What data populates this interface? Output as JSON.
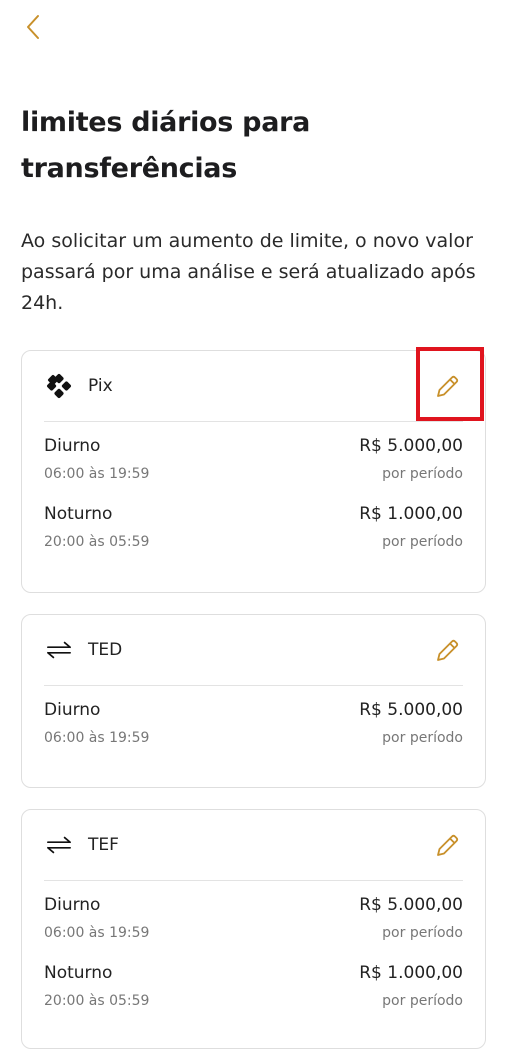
{
  "title": "limites diários para transferências",
  "description": "Ao solicitar um aumento de limite, o novo valor passará por uma análise e será atualizado após 24h.",
  "colors": {
    "accent": "#c8902a",
    "highlight": "#e0141e"
  },
  "cards": [
    {
      "name": "Pix",
      "icon": "pix-icon",
      "rows": [
        {
          "label": "Diurno",
          "hours": "06:00 às 19:59",
          "amount": "R$ 5.000,00",
          "period": "por período"
        },
        {
          "label": "Noturno",
          "hours": "20:00 às 05:59",
          "amount": "R$ 1.000,00",
          "period": "por período"
        }
      ]
    },
    {
      "name": "TED",
      "icon": "transfer-arrows-icon",
      "rows": [
        {
          "label": "Diurno",
          "hours": "06:00 às 19:59",
          "amount": "R$ 5.000,00",
          "period": "por período"
        }
      ]
    },
    {
      "name": "TEF",
      "icon": "transfer-arrows-icon",
      "rows": [
        {
          "label": "Diurno",
          "hours": "06:00 às 19:59",
          "amount": "R$ 5.000,00",
          "period": "por período"
        },
        {
          "label": "Noturno",
          "hours": "20:00 às 05:59",
          "amount": "R$ 1.000,00",
          "period": "por período"
        }
      ]
    }
  ]
}
